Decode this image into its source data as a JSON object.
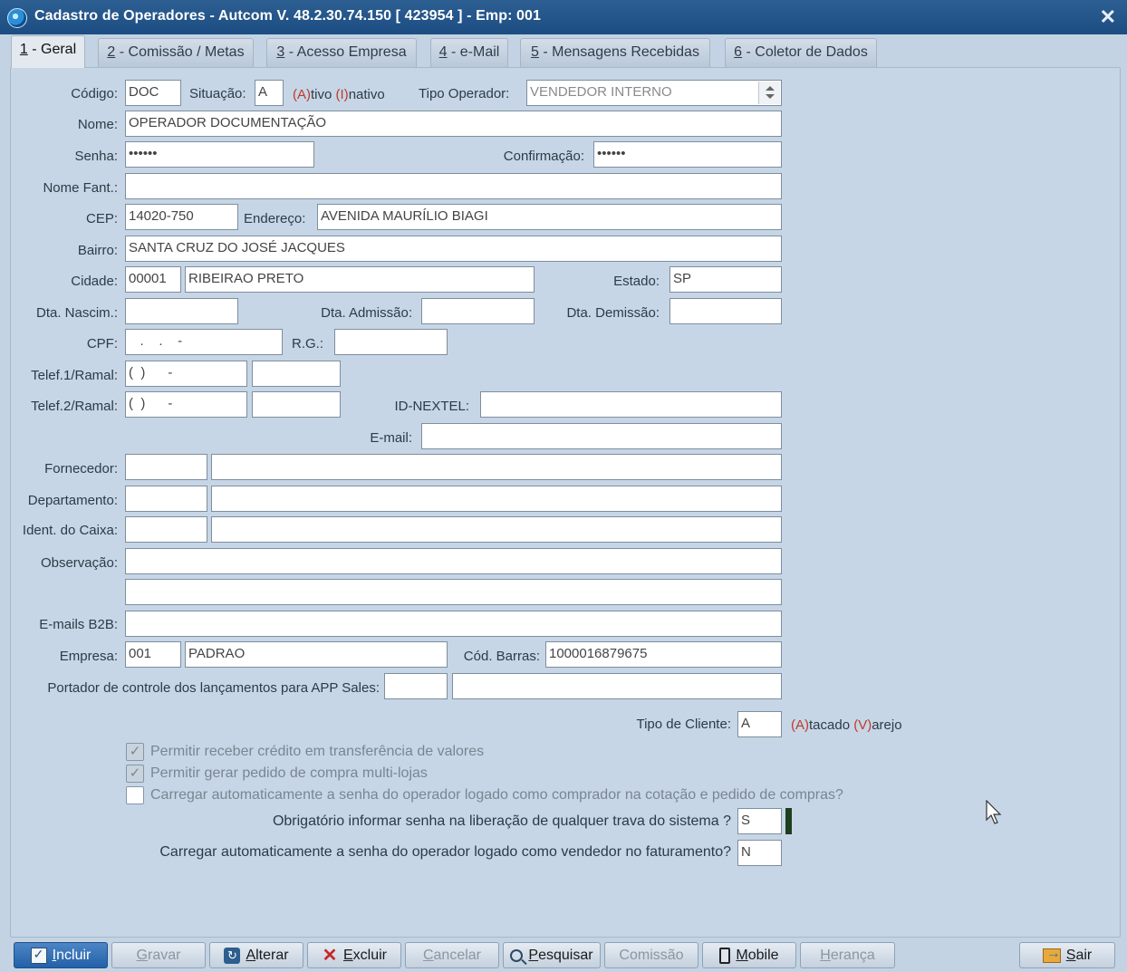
{
  "window": {
    "title": "Cadastro de Operadores   -   Autcom V. 48.2.30.74.150 [ 423954 ] - Emp: 001"
  },
  "tabs": [
    {
      "num": "1",
      "label": " - Geral"
    },
    {
      "num": "2",
      "label": " - Comissão / Metas"
    },
    {
      "num": "3",
      "label": " - Acesso Empresa"
    },
    {
      "num": "4",
      "label": " - e-Mail"
    },
    {
      "num": "5",
      "label": " - Mensagens Recebidas"
    },
    {
      "num": "6",
      "label": " - Coletor de Dados"
    }
  ],
  "form": {
    "codigo": {
      "label": "Código:",
      "value": "DOC"
    },
    "situacao": {
      "label": "Situação:",
      "value": "A",
      "hint_a": "(A)",
      "hint_a_rest": "tivo ",
      "hint_i": "(I)",
      "hint_i_rest": "nativo"
    },
    "tipo_operador": {
      "label": "Tipo Operador:",
      "value": "VENDEDOR INTERNO"
    },
    "nome": {
      "label": "Nome:",
      "value": "OPERADOR DOCUMENTAÇÃO"
    },
    "senha": {
      "label": "Senha:",
      "value": "••••••"
    },
    "confirmacao": {
      "label": "Confirmação:",
      "value": "••••••"
    },
    "nome_fant": {
      "label": "Nome Fant.:",
      "value": ""
    },
    "cep": {
      "label": "CEP:",
      "value": "14020-750"
    },
    "endereco": {
      "label": "Endereço:",
      "value": "AVENIDA MAURÍLIO BIAGI"
    },
    "bairro": {
      "label": "Bairro:",
      "value": "SANTA CRUZ DO JOSÉ JACQUES"
    },
    "cidade": {
      "label": "Cidade:",
      "code": "00001",
      "value": "RIBEIRAO PRETO"
    },
    "estado": {
      "label": "Estado:",
      "value": "SP"
    },
    "dta_nascim": {
      "label": "Dta. Nascim.:",
      "value": ""
    },
    "dta_admissao": {
      "label": "Dta. Admissão:",
      "value": ""
    },
    "dta_demissao": {
      "label": "Dta. Demissão:",
      "value": ""
    },
    "cpf": {
      "label": "CPF:",
      "value": "   .    .    -"
    },
    "rg": {
      "label": "R.G.:",
      "value": ""
    },
    "telef1": {
      "label": "Telef.1/Ramal:",
      "value": "(  )      -",
      "ramal": ""
    },
    "telef2": {
      "label": "Telef.2/Ramal:",
      "value": "(  )      -",
      "ramal": ""
    },
    "id_nextel": {
      "label": "ID-NEXTEL:",
      "value": ""
    },
    "email": {
      "label": "E-mail:",
      "value": ""
    },
    "fornecedor": {
      "label": "Fornecedor:",
      "code": "",
      "value": ""
    },
    "departamento": {
      "label": "Departamento:",
      "code": "",
      "value": ""
    },
    "ident_caixa": {
      "label": "Ident. do Caixa:",
      "code": "",
      "value": ""
    },
    "observacao": {
      "label": "Observação:",
      "line1": "",
      "line2": ""
    },
    "emails_b2b": {
      "label": "E-mails B2B:",
      "value": ""
    },
    "empresa": {
      "label": "Empresa:",
      "code": "001",
      "value": "PADRAO"
    },
    "cod_barras": {
      "label": "Cód. Barras:",
      "value": "1000016879675"
    },
    "portador": {
      "label": "Portador de controle dos lançamentos para APP Sales:",
      "code": "",
      "value": ""
    },
    "tipo_cliente": {
      "label": "Tipo de Cliente:",
      "value": "A",
      "hint_a": "(A)",
      "hint_a_rest": "tacado ",
      "hint_v": "(V)",
      "hint_v_rest": "arejo"
    }
  },
  "options": {
    "permitir_credito": {
      "label": "Permitir receber crédito em transferência de valores",
      "checked": true
    },
    "permitir_multilojas": {
      "label": "Permitir gerar pedido de compra multi-lojas",
      "checked": true
    },
    "carregar_senha_comprador": {
      "label": "Carregar automaticamente a senha do operador logado como comprador na cotação e pedido de compras?",
      "checked": false
    },
    "obrigatorio_senha": {
      "label": "Obrigatório informar senha na liberação de qualquer trava do sistema ?",
      "value": "S"
    },
    "carregar_senha_vendedor": {
      "label": "Carregar automaticamente a senha do operador logado como vendedor no faturamento?",
      "value": "N"
    }
  },
  "toolbar": {
    "incluir": {
      "u": "I",
      "rest": "ncluir"
    },
    "gravar": {
      "u": "G",
      "rest": "ravar"
    },
    "alterar": {
      "u": "A",
      "rest": "lterar"
    },
    "excluir": {
      "u": "E",
      "rest": "xcluir"
    },
    "cancelar": {
      "u": "C",
      "rest": "ancelar"
    },
    "pesquisar": {
      "u": "P",
      "rest": "esquisar"
    },
    "comissao": {
      "u": "",
      "rest": "Comissão"
    },
    "mobile": {
      "u": "M",
      "rest": "obile"
    },
    "heranca": {
      "u": "H",
      "rest": "erança"
    },
    "sair": {
      "u": "S",
      "rest": "air"
    }
  }
}
